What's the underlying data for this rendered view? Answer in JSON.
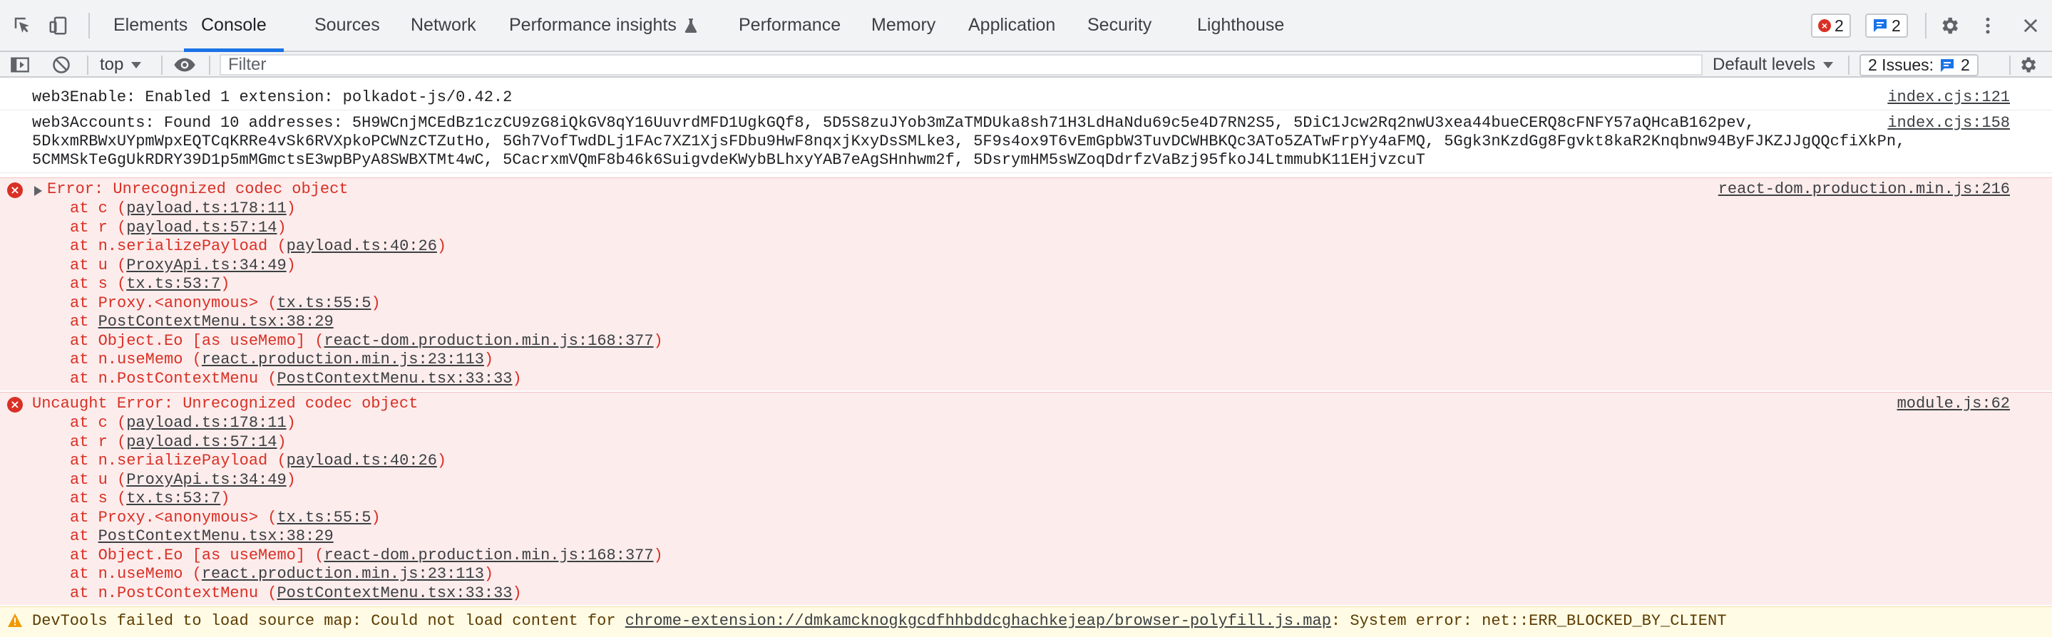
{
  "tabs": [
    {
      "label": "Elements"
    },
    {
      "label": "Console"
    },
    {
      "label": "Sources"
    },
    {
      "label": "Network"
    },
    {
      "label": "Performance insights"
    },
    {
      "label": "Performance"
    },
    {
      "label": "Memory"
    },
    {
      "label": "Application"
    },
    {
      "label": "Security"
    },
    {
      "label": "Lighthouse"
    }
  ],
  "status": {
    "errors": "2",
    "messages": "2"
  },
  "console_toolbar": {
    "context": "top",
    "filter_placeholder": "Filter",
    "levels": "Default levels",
    "issues_label": "2 Issues:",
    "issues_count": "2"
  },
  "messages": {
    "m1": {
      "text": "web3Enable: Enabled 1 extension: polkadot-js/0.42.2",
      "source": "index.cjs:121"
    },
    "m2": {
      "source": "index.cjs:158",
      "lines": [
        "web3Accounts: Found 10 addresses: 5H9WCnjMCEdBz1czCU9zG8iQkGV8qY16UuvrdMFD1UgkGQf8, 5D5S8zuJYob3mZaTMDUka8sh71H3LdHaNdu69c5e4D7RN2S5, 5DiC1Jcw2Rq2nwU3xea44bueCERQ8cFNFY57aQHcaB162pev,",
        "5DkxmRBWxUYpmWpxEQTCqKRRe4vSk6RVXpkoPCWNzCTZutHo, 5Gh7VofTwdDLj1FAc7XZ1XjsFDbu9HwF8nqxjKxyDsSMLke3, 5F9s4ox9T6vEmGpbW3TuvDCWHBKQc3ATo5ZATwFrpYy4aFMQ, 5Ggk3nKzdGg8Fgvkt8kaR2Knqbnw94ByFJKZJJgQQcfiXkPn,",
        "5CMMSkTeGgUkRDRY39D1p5mMGmctsE3wpBPyA8SWBXTMt4wC, 5CacrxmVQmF8b46k6SuigvdeKWybBLhxyYAB7eAgSHnhwm2f, 5DsrymHM5sWZoqDdrfzVaBzj95fkoJ4LtmmubK11EHjvzcuT"
      ]
    },
    "m3": {
      "text": "Error: Unrecognized codec object",
      "source": "react-dom.production.min.js:216"
    },
    "m4": {
      "text": "Uncaught Error: Unrecognized codec object",
      "source": "module.js:62"
    },
    "stack": [
      {
        "pre": "at c (",
        "link": "payload.ts:178:11",
        "post": ")"
      },
      {
        "pre": "at r (",
        "link": "payload.ts:57:14",
        "post": ")"
      },
      {
        "pre": "at n.serializePayload (",
        "link": "payload.ts:40:26",
        "post": ")"
      },
      {
        "pre": "at u (",
        "link": "ProxyApi.ts:34:49",
        "post": ")"
      },
      {
        "pre": "at s (",
        "link": "tx.ts:53:7",
        "post": ")"
      },
      {
        "pre": "at Proxy.<anonymous> (",
        "link": "tx.ts:55:5",
        "post": ")"
      },
      {
        "pre": "at ",
        "link": "PostContextMenu.tsx:38:29",
        "post": ""
      },
      {
        "pre": "at Object.Eo [as useMemo] (",
        "link": "react-dom.production.min.js:168:377",
        "post": ")"
      },
      {
        "pre": "at n.useMemo (",
        "link": "react.production.min.js:23:113",
        "post": ")"
      },
      {
        "pre": "at n.PostContextMenu (",
        "link": "PostContextMenu.tsx:33:33",
        "post": ")"
      }
    ],
    "m5": {
      "pre": "DevTools failed to load source map: Could not load content for ",
      "link": "chrome-extension://dmkamcknogkgcdfhhbddcghachkejeap/browser-polyfill.js.map",
      "post": ": System error: net::ERR_BLOCKED_BY_CLIENT"
    }
  },
  "colors": {
    "accent": "#1a73e8",
    "error": "#d93025",
    "error_bg": "#fcecec",
    "warning_bg": "#fffbe5",
    "warning_icon": "#f29900"
  }
}
